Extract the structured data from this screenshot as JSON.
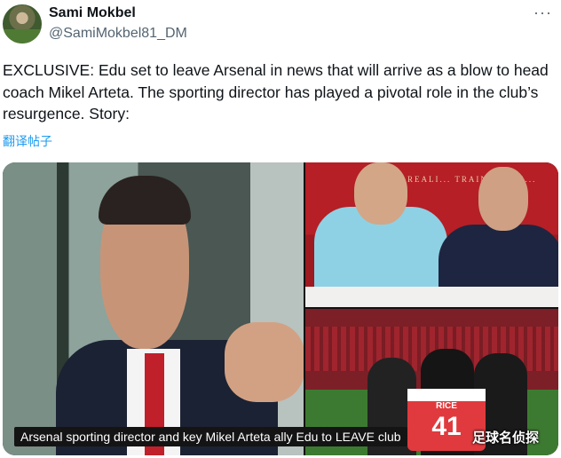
{
  "author": {
    "display_name": "Sami Mokbel",
    "handle": "@SamiMokbel81_DM"
  },
  "more_icon": "more-horizontal-icon",
  "tweet": {
    "text": "EXCLUSIVE: Edu set to leave Arsenal in news that will arrive as a blow to head coach Mikel Arteta. The sporting director has played a pivotal role in the club’s resurgence. Story:",
    "translate_label": "翻译帖子"
  },
  "media": {
    "top_right_banner": "REALI... TRAINING CE...",
    "jersey_name": "RICE",
    "jersey_number": "41",
    "caption": "Arsenal sporting director and key Mikel Arteta ally Edu to LEAVE club",
    "watermark": "足球名侦探"
  },
  "colors": {
    "link": "#1d9bf0",
    "text": "#0f1419",
    "muted": "#536471",
    "arsenal_red": "#b51f25"
  }
}
